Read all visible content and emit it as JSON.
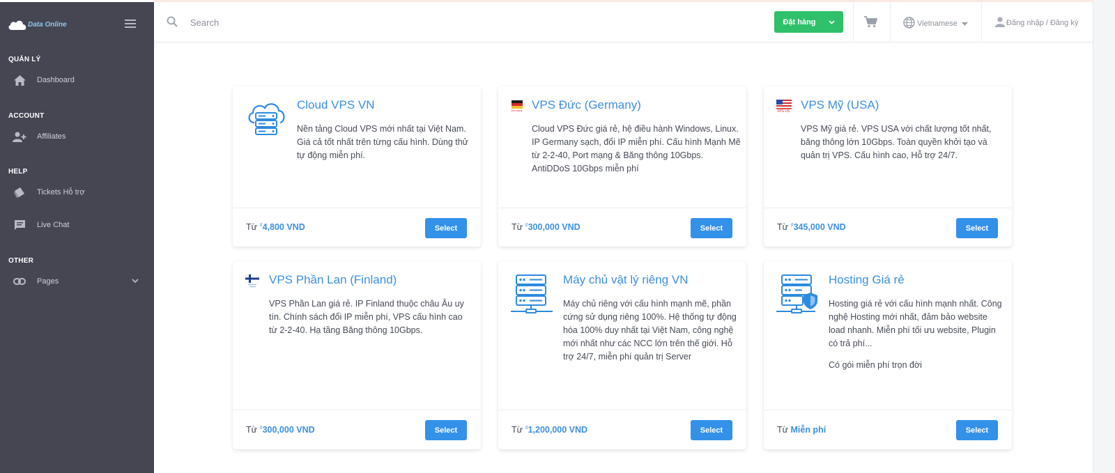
{
  "brand": {
    "name": "Data Online"
  },
  "sidebar": {
    "sections": [
      {
        "title": "QUẢN LÝ",
        "items": [
          {
            "label": "Dashboard",
            "icon": "home-icon"
          }
        ]
      },
      {
        "title": "ACCOUNT",
        "items": [
          {
            "label": "Affiliates",
            "icon": "user-plus-icon"
          }
        ]
      },
      {
        "title": "HELP",
        "items": [
          {
            "label": "Tickets Hỗ trợ",
            "icon": "ticket-icon"
          },
          {
            "label": "Live Chat",
            "icon": "chat-icon"
          }
        ]
      },
      {
        "title": "OTHER",
        "items": [
          {
            "label": "Pages",
            "icon": "link-icon"
          }
        ]
      }
    ]
  },
  "topbar": {
    "search_placeholder": "Search",
    "order_label": "Đặt hàng",
    "language": "Vietnamese",
    "login_label": "Đăng nhập / Đăng ký"
  },
  "colors": {
    "sidebar_bg": "#454652",
    "accent": "#3491ea",
    "order_green": "#2ec06a",
    "title_blue": "#3c8fe0"
  },
  "cards": [
    {
      "title": "Cloud VPS VN",
      "desc": [
        "Nền tảng Cloud VPS mới nhất tại Việt Nam. Giá cả tốt nhất trên từng cấu hình. Dùng thử tự động miễn phí."
      ],
      "price_prefix": "Từ ",
      "currency": "₫",
      "price": "4,800 VND",
      "select": "Select",
      "icon": "cloud-server-icon"
    },
    {
      "title": "VPS Đức (Germany)",
      "desc": [
        "Cloud VPS Đức giá rẻ, hệ điều hành Windows, Linux. IP Germany sạch, đổi IP miễn phí. Cấu hình Mạnh Mẽ từ 2-2-40, Port mạng & Băng thông 10Gbps. AntiDDoS 10Gbps miễn phí"
      ],
      "price_prefix": "Từ ",
      "currency": "₫",
      "price": "300,000 VND",
      "select": "Select",
      "icon": "germany-flag-icon",
      "flag_caption": "Germany"
    },
    {
      "title": "VPS Mỹ (USA)",
      "desc": [
        "VPS Mỹ giá rẻ. VPS USA với chất lượng tốt nhất, băng thông lớn 10Gbps. Toàn quyền khởi tạo và quản trị VPS. Cấu hình cao, Hỗ trợ 24/7."
      ],
      "price_prefix": "Từ ",
      "currency": "₫",
      "price": "345,000 VND",
      "select": "Select",
      "icon": "usa-flag-icon",
      "flag_caption": "VPS US"
    },
    {
      "title": "VPS Phần Lan (Finland)",
      "desc": [
        "VPS Phần Lan giá rẻ. IP Finland thuộc châu Âu uy tín. Chính sách đổi IP miễn phí, VPS cấu hình cao từ 2-2-40. Hạ tầng Băng thông 10Gbps."
      ],
      "price_prefix": "Từ ",
      "currency": "₫",
      "price": "300,000 VND",
      "select": "Select",
      "icon": "finland-flag-icon"
    },
    {
      "title": "Máy chủ vật lý riêng VN",
      "desc": [
        "Máy chủ riêng với cấu hình mạnh mẽ, phần cứng sử dụng riêng 100%. Hệ thống tự động hóa 100% duy nhất tại Việt Nam, công nghệ mới nhất như các NCC lớn trên thế giới. Hỗ trợ 24/7, miễn phí quản trị Server"
      ],
      "price_prefix": "Từ ",
      "currency": "₫",
      "price": "1,200,000 VND",
      "select": "Select",
      "icon": "server-rack-icon"
    },
    {
      "title": "Hosting Giá rẻ",
      "desc": [
        "Hosting giá rẻ với cấu hình mạnh nhất. Công nghệ Hosting mới nhất, đảm bảo website load nhanh. Miễn phí tối ưu website, Plugin có trả phí...",
        "Có gói miễn phí trọn đời"
      ],
      "price_prefix": "Từ ",
      "currency": "",
      "price": "Miễn phí",
      "select": "Select",
      "icon": "server-shield-icon"
    }
  ]
}
